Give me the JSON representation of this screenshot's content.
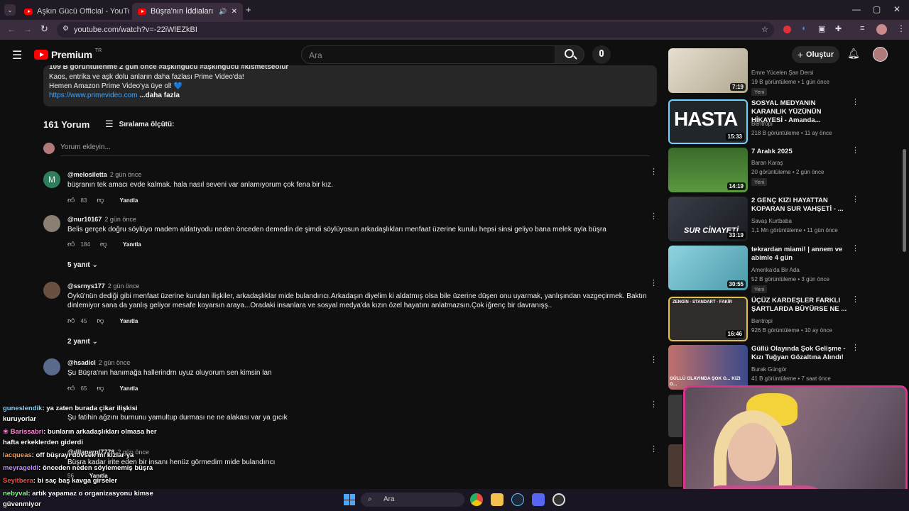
{
  "browser": {
    "tabs": [
      {
        "title": "Aşkın Gücü Official - YouTube"
      },
      {
        "title": "Büşra'nın İddiaları Buket'i Ç"
      }
    ],
    "url": "youtube.com/watch?v=-22iWlEZkBI"
  },
  "youtube": {
    "logo": "Premium",
    "logo_region": "TR",
    "search_placeholder": "Ara",
    "create_label": "Oluştur"
  },
  "description": {
    "line0": "109 B görüntülenme  2 gün önce  #aşkıngücü #aşkıngücü #kısmetseolur",
    "line1": "Kaos, entrika ve aşk dolu anların daha fazlası Prime Video'da!",
    "line2": "Hemen Amazon Prime Video'ya üye ol! 💙",
    "link": "https://www.primevideo.com",
    "more": "...daha fazla"
  },
  "comments_header": {
    "count": "161 Yorum",
    "sort": "Sıralama ölçütü:",
    "add_placeholder": "Yorum ekleyin..."
  },
  "comments": [
    {
      "author": "@melosiletta",
      "ago": "2 gün önce",
      "text": "büşranın tek amacı evde kalmak. hala nasıl seveni var anlamıyorum çok fena bir kız.",
      "likes": "83",
      "reply": "Yanıtla",
      "avatar_letter": "M"
    },
    {
      "author": "@nur10167",
      "ago": "2 gün önce",
      "text": "Belis gerçek doğru söylüyo madem aldatıyodu neden önceden demedin de şimdi söylüyosun arkadaşlıkları menfaat üzerine kurulu hepsi sinsi geliyo bana melek ayla büşra",
      "likes": "184",
      "reply": "Yanıtla",
      "replies": "5 yanıt"
    },
    {
      "author": "@ssrnys177",
      "ago": "2 gün önce",
      "text": "Öykü'nün dediği gibi menfaat üzerine kurulan ilişkiler, arkadaşlıklar mide bulandırıcı.Arkadaşın diyelim ki aldatmış olsa bile üzerine düşen onu uyarmak, yanlışından vazgeçirmek. Baktın dinlemiyor sana da yanlış geliyor mesafe koyarsın araya...Oradaki insanlara ve sosyal medya'da kızın özel hayatını anlatmazsın.Çok iğrenç bir davranışş..",
      "likes": "45",
      "reply": "Yanıtla",
      "replies": "2 yanıt"
    },
    {
      "author": "@hsadicl",
      "ago": "2 gün önce",
      "text": "Şu Büşra'nın hanımağa hallerindrn uyuz oluyorum sen kimsin lan",
      "likes": "65",
      "reply": "Yanıtla"
    },
    {
      "author": "",
      "ago": "",
      "text": "Şu fatihin ağzını burnunu yamultup durması ne ne alakası var ya gıcık",
      "likes": "",
      "reply": ""
    },
    {
      "author": "@dilanerpl7778",
      "ago": "2 gün önce",
      "text": "Büşra kadar irite eden bir insanı henüz görmedim mide bulandırıcı",
      "likes": "56",
      "reply": "Yanıtla"
    }
  ],
  "sidebar": [
    {
      "title": "",
      "channel": "Emre Yücelen Şan Dersi",
      "meta": "19 B görüntüleme • 1 gün önce",
      "badge": "Yeni",
      "duration": "7:19",
      "thumb_color": "#d8d0c0"
    },
    {
      "title": "SOSYAL MEDYANIN KARANLIK YÜZÜNÜN HİKAYESİ - Amanda...",
      "channel": "Bentropi",
      "meta": "218 B görüntüleme • 11 ay önce",
      "badge": "",
      "duration": "15:33",
      "thumb_text": "HASTA",
      "thumb_color": "#20262a"
    },
    {
      "title": "7 Aralık 2025",
      "channel": "Baran Karaş",
      "meta": "20 görüntüleme • 2 gün önce",
      "badge": "Yeni",
      "duration": "14:19",
      "thumb_color": "#4c8a3a"
    },
    {
      "title": "2 GENÇ KIZI HAYATTAN KOPARAN SUR VAHŞETİ - ...",
      "channel": "Savaş Kurtbaba",
      "meta": "1,1 Mn görüntüleme • 11 gün önce",
      "badge": "",
      "duration": "33:19",
      "thumb_text": "SUR CİNAYETİ",
      "thumb_color": "#2a2e38"
    },
    {
      "title": "tekrardan miami! | annem ve abimle 4 gün",
      "channel": "Amerika'da Bir Ada",
      "meta": "52 B görüntüleme • 3 gün önce",
      "badge": "Yeni",
      "duration": "30:55",
      "thumb_color": "#6fb7c4"
    },
    {
      "title": "ÜÇÜZ KARDEŞLER FARKLI ŞARTLARDA BÜYÜRSE NE ...",
      "channel": "Bentropi",
      "meta": "926 B görüntüleme • 10 ay önce",
      "badge": "",
      "duration": "16:46",
      "thumb_text": "ZENGİN · STANDART · FAKİR",
      "thumb_color": "#2f2c2a"
    },
    {
      "title": "Güllü Olayında Şok Gelişme - Kızı Tuğyan Gözaltına Alındı!",
      "channel": "Burak Güngör",
      "meta": "41 B görüntüleme • 7 saat önce",
      "badge": "",
      "duration": "",
      "thumb_text": "GÜLLÜ OLAYINDA ŞOK G... KIZI G...",
      "thumb_color": "#8a4a40"
    }
  ],
  "chat": [
    {
      "user": "guneslendik",
      "msg": ": ya zaten burada çikar ilişkisi",
      "cont": "kuruyorlar",
      "color": "#7fd4ff"
    },
    {
      "user": "Barissabri",
      "msg": ": bunların arkadaşlıkları olmasa her",
      "cont": "hafta erkeklerden giderdi",
      "color": "#ff8ad8"
    },
    {
      "user": "lacqueas",
      "msg": ": off büşrayı dövsek mi kızlar ya",
      "cont": "",
      "color": "#ff9a4a"
    },
    {
      "user": "meyrageldi",
      "msg": ": önceden neden söylememiş büşra",
      "cont": "",
      "color": "#c58aff"
    },
    {
      "user": "Seyitbera",
      "msg": ": bi saç baş kavga girseler",
      "cont": "",
      "color": "#ff4a4a"
    },
    {
      "user": "nebyval",
      "msg": ": artık yapamaz o organizasyonu kimse",
      "cont": "güvenmiyor",
      "color": "#7fff7f"
    }
  ],
  "taskbar": {
    "search": "Ara"
  }
}
